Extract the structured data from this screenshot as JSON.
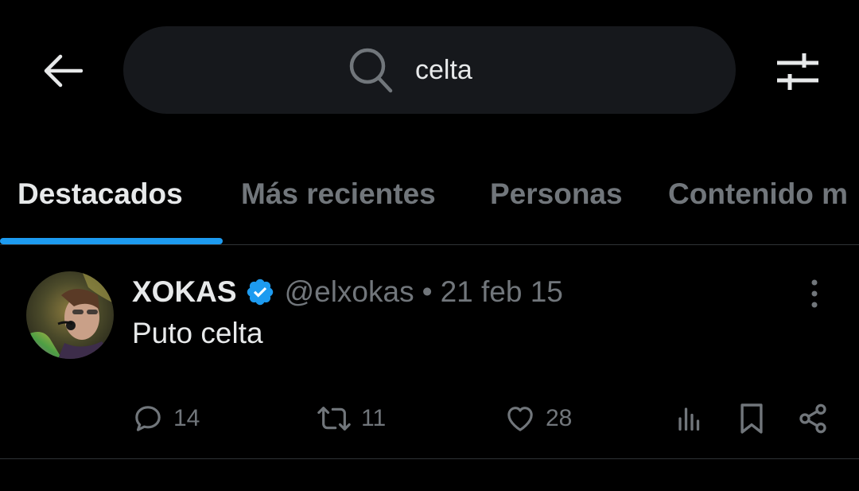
{
  "search": {
    "query": "celta",
    "icons": {
      "back": "arrow-left-icon",
      "search": "search-icon",
      "filter": "sliders-icon"
    }
  },
  "tabs": [
    {
      "label": "Destacados",
      "active": true
    },
    {
      "label": "Más recientes",
      "active": false
    },
    {
      "label": "Personas",
      "active": false
    },
    {
      "label": "Contenido m",
      "active": false
    }
  ],
  "tweet": {
    "display_name": "XOKAS",
    "verified": true,
    "handle": "@elxokas",
    "separator": "•",
    "date": "21 feb 15",
    "text": "Puto celta",
    "replies": "14",
    "retweets": "11",
    "likes": "28"
  },
  "colors": {
    "background": "#000000",
    "accent": "#1d9bf0",
    "text_primary": "#e7e9ea",
    "text_secondary": "#71767b",
    "search_bg": "#16181c"
  }
}
